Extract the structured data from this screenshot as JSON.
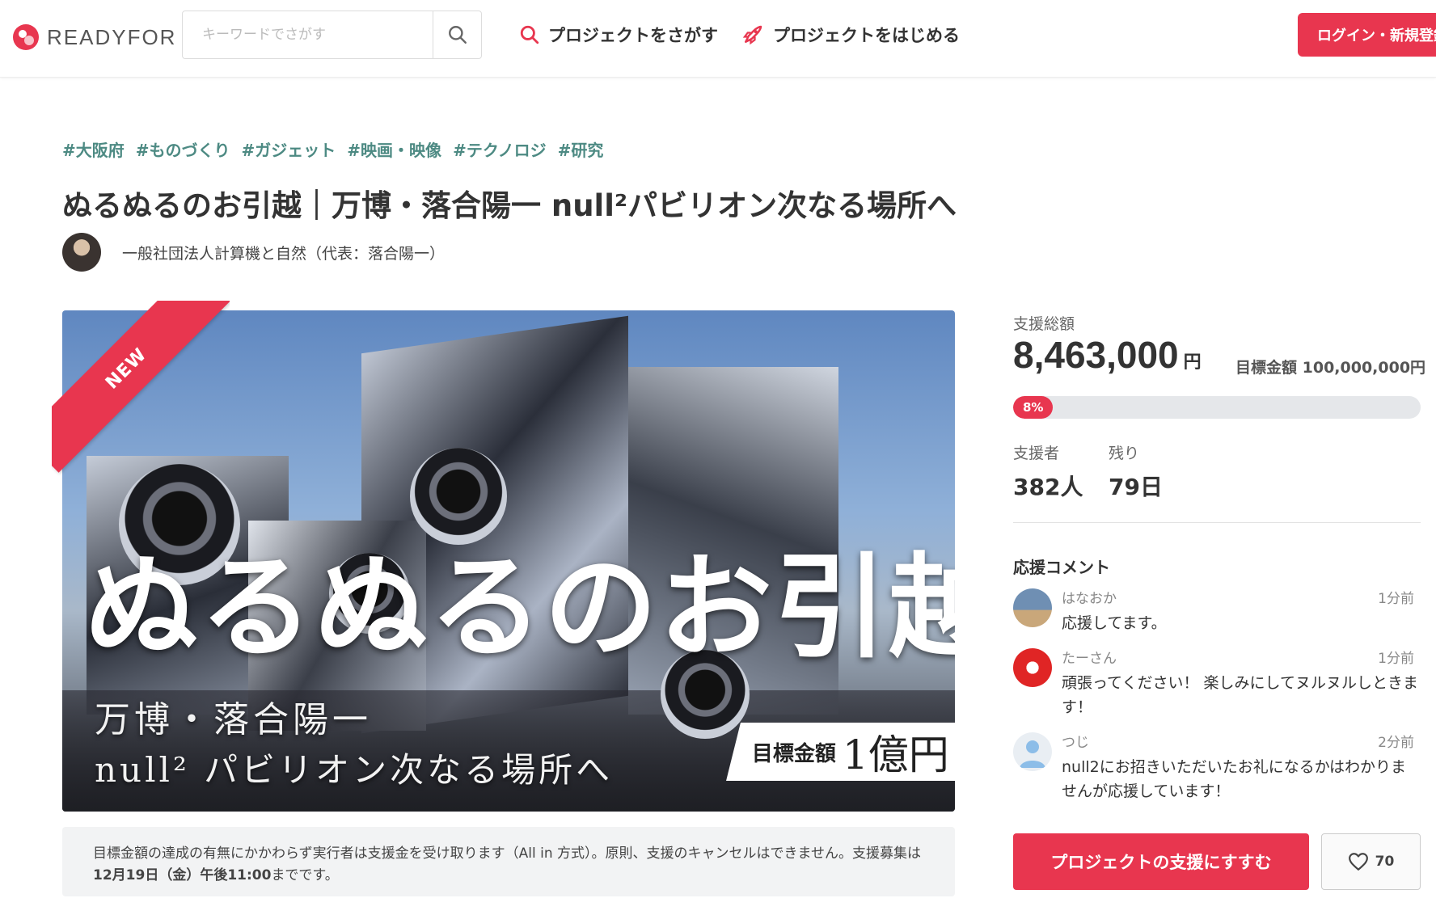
{
  "header": {
    "logo_text": "READYFOR",
    "search_placeholder": "キーワードでさがす",
    "nav_find": "プロジェクトをさがす",
    "nav_start": "プロジェクトをはじめる",
    "login": "ログイン・新規登録"
  },
  "project": {
    "tags": [
      "#大阪府",
      "#ものづくり",
      "#ガジェット",
      "#映画・映像",
      "#テクノロジ",
      "#研究"
    ],
    "title": "ぬるぬるのお引越｜万博・落合陽一 null²パビリオン次なる場所へ",
    "owner": "一般社団法人計算機と自然（代表：落合陽一）",
    "ribbon": "NEW",
    "hero": {
      "main": "ぬるぬるのお引越",
      "sub1": "万博・落合陽一",
      "sub2": "null² パビリオン次なる場所へ",
      "goal_label": "目標金額",
      "goal_value": "1億円"
    },
    "notice_part1": "目標金額の達成の有無にかかわらず実行者は支援金を受け取ります（All in 方式）。原則、支援のキャンセルはできません。支援募集は",
    "notice_bold": "12月19日（金）午後11:00",
    "notice_part2": "までです。"
  },
  "stats": {
    "total_label": "支援総額",
    "total_value": "8,463,000",
    "total_unit": "円",
    "target_label": "目標金額",
    "target_value": "100,000,000円",
    "progress_label": "8%",
    "progress_fraction": 0.0846,
    "backers_label": "支援者",
    "backers_value": "382人",
    "remaining_label": "残り",
    "remaining_value": "79日"
  },
  "comments": {
    "title": "応援コメント",
    "items": [
      {
        "name": "はなおか",
        "time": "1分前",
        "body": "応援してます。"
      },
      {
        "name": "たーさん",
        "time": "1分前",
        "body": "頑張ってください！ 楽しみにしてヌルヌルしときます！"
      },
      {
        "name": "つじ",
        "time": "2分前",
        "body": "null2にお招きいただいたお礼になるかはわかりませんが応援しています！"
      }
    ]
  },
  "actions": {
    "support": "プロジェクトの支援にすすむ",
    "favorite_count": "70"
  },
  "colors": {
    "accent": "#e8364f",
    "tag": "#4d8a83"
  }
}
